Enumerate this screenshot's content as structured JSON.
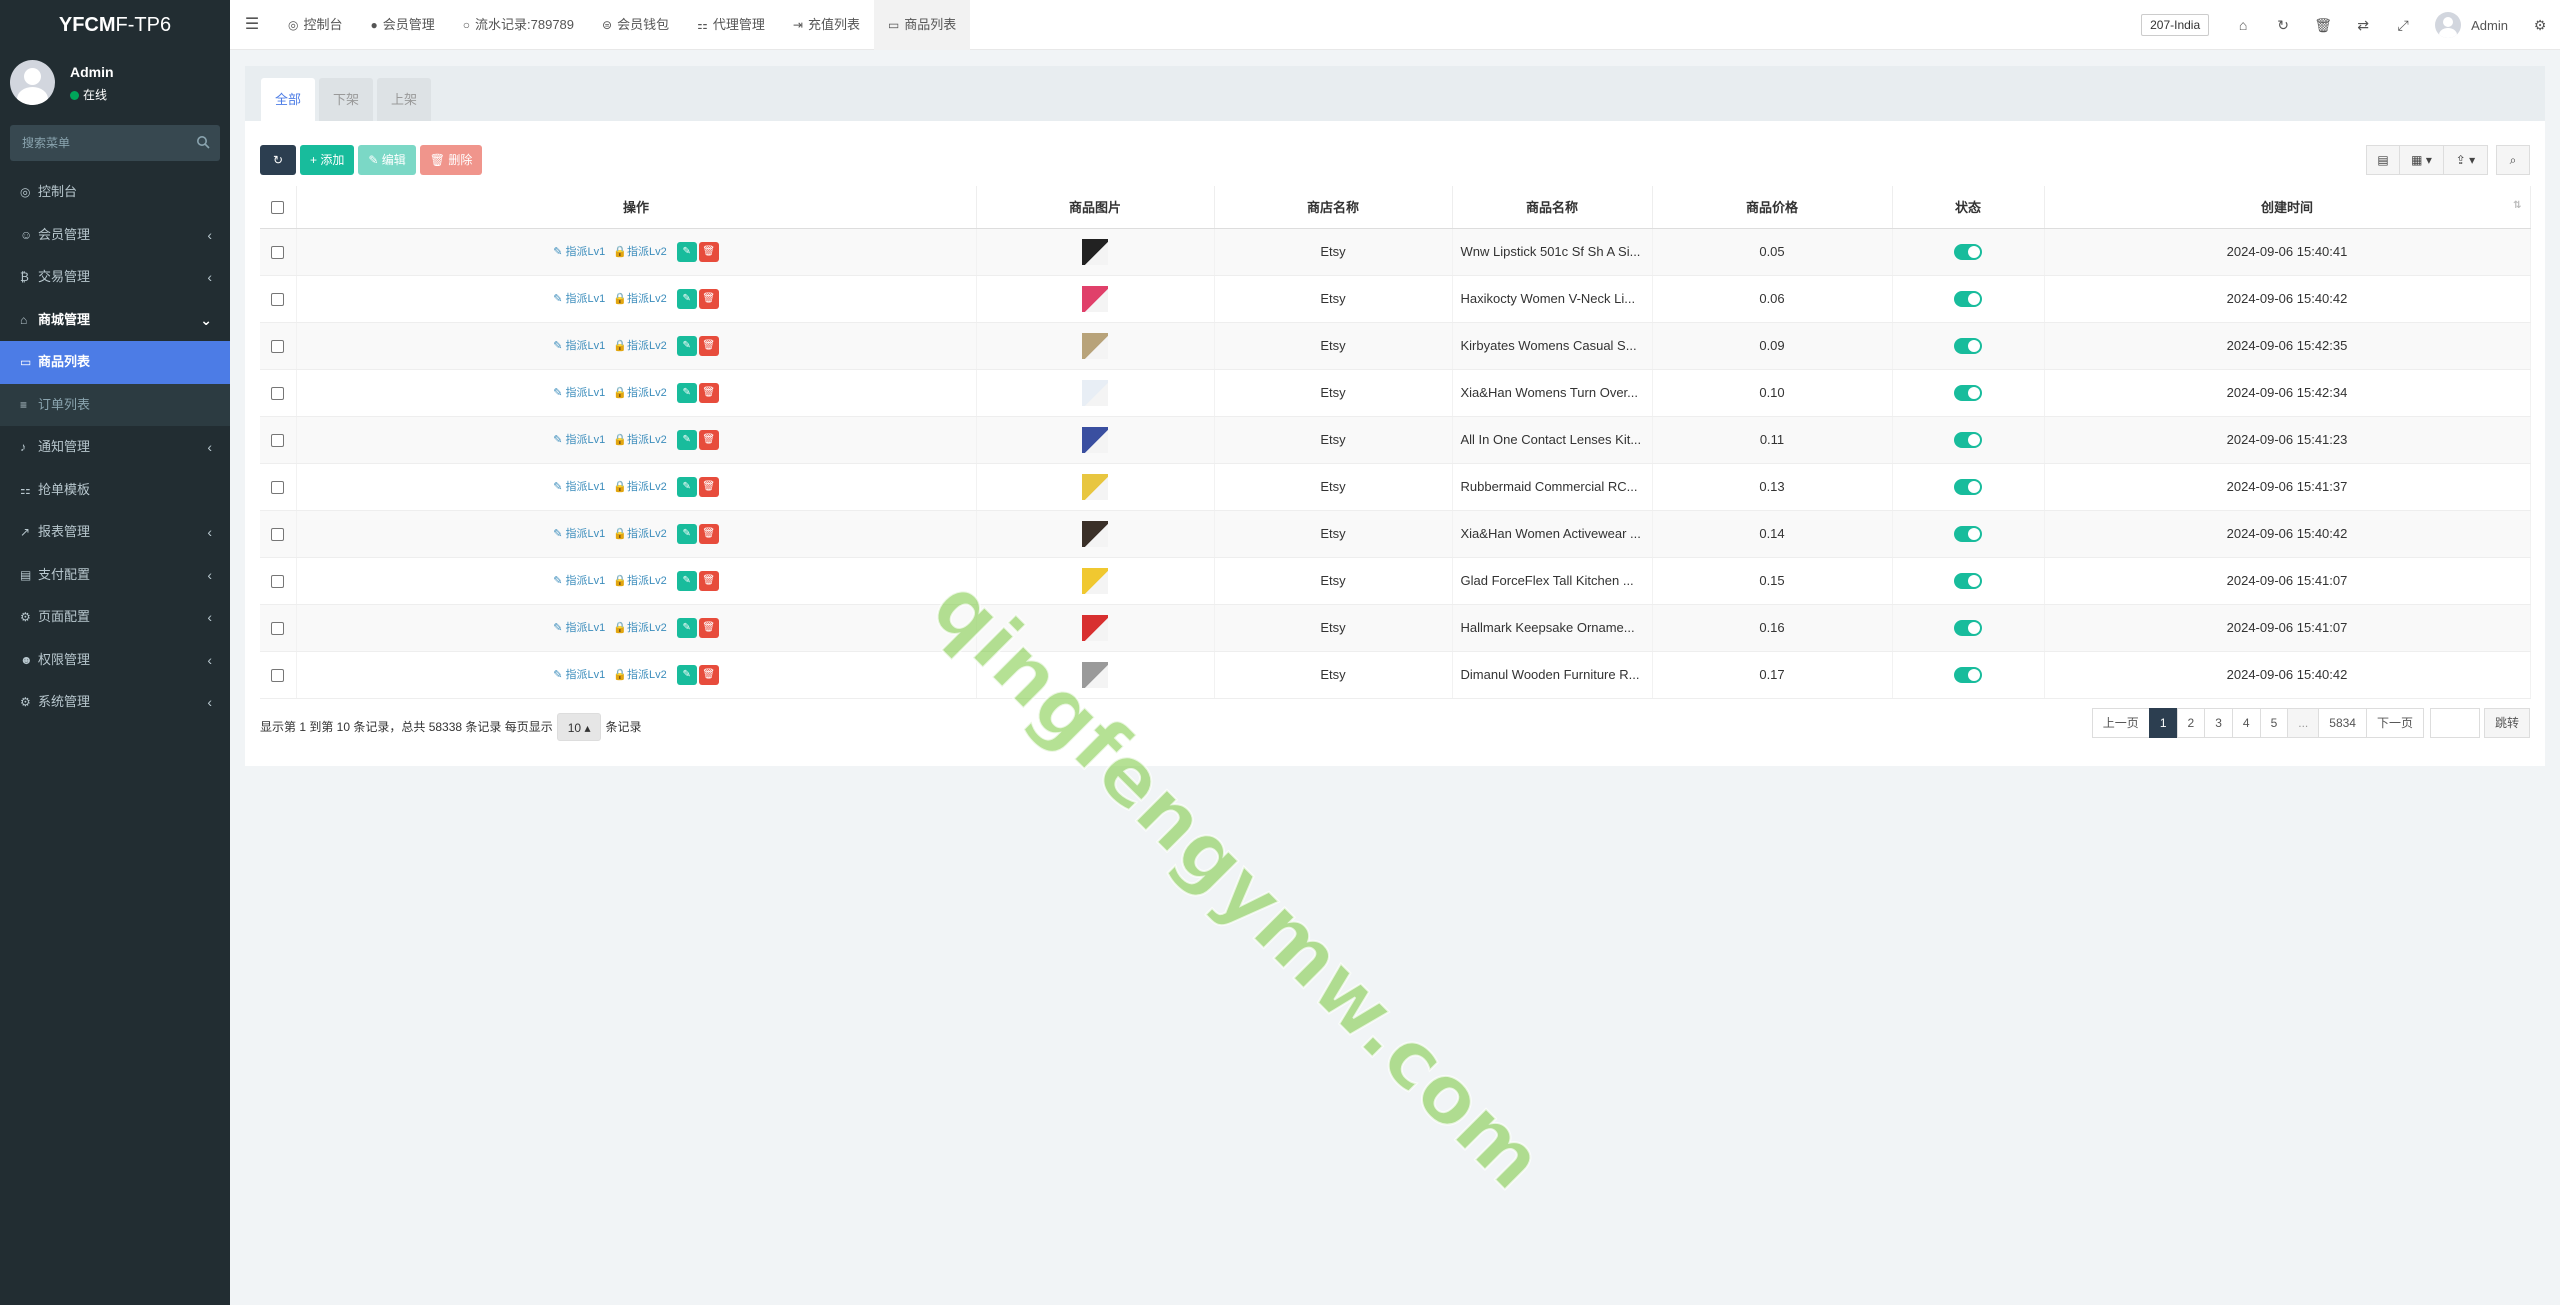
{
  "app": {
    "logo_bold": "YFCM",
    "logo_rest": "F-TP6"
  },
  "user": {
    "name": "Admin",
    "status": "在线"
  },
  "sidebar": {
    "search_placeholder": "搜索菜单",
    "items": [
      {
        "label": "控制台",
        "icon": "dashboard-icon",
        "glyph": "◎",
        "arrow": ""
      },
      {
        "label": "会员管理",
        "icon": "user-circle-icon",
        "glyph": "☺",
        "arrow": "‹"
      },
      {
        "label": "交易管理",
        "icon": "bitcoin-icon",
        "glyph": "₿",
        "arrow": "‹"
      },
      {
        "label": "商城管理",
        "icon": "home-icon",
        "glyph": "⌂",
        "arrow": "⌄"
      },
      {
        "label": "商品列表",
        "icon": "desktop-icon",
        "glyph": "▭",
        "arrow": ""
      },
      {
        "label": "订单列表",
        "icon": "list-icon",
        "glyph": "≡",
        "arrow": ""
      },
      {
        "label": "通知管理",
        "icon": "bell-icon",
        "glyph": "♪",
        "arrow": "‹"
      },
      {
        "label": "抢单模板",
        "icon": "sitemap-icon",
        "glyph": "⚏",
        "arrow": ""
      },
      {
        "label": "报表管理",
        "icon": "line-chart-icon",
        "glyph": "↗",
        "arrow": "‹"
      },
      {
        "label": "支付配置",
        "icon": "credit-card-icon",
        "glyph": "▤",
        "arrow": "‹"
      },
      {
        "label": "页面配置",
        "icon": "gear-icon",
        "glyph": "⚙",
        "arrow": "‹"
      },
      {
        "label": "权限管理",
        "icon": "users-icon",
        "glyph": "☻",
        "arrow": "‹"
      },
      {
        "label": "系统管理",
        "icon": "cogs-icon",
        "glyph": "⚙",
        "arrow": "‹"
      }
    ]
  },
  "topnav": {
    "tabs": [
      {
        "label": "控制台",
        "glyph": "◎"
      },
      {
        "label": "会员管理",
        "glyph": "●"
      },
      {
        "label": "流水记录:789789",
        "glyph": "○"
      },
      {
        "label": "会员钱包",
        "glyph": "⊜"
      },
      {
        "label": "代理管理",
        "glyph": "⚏"
      },
      {
        "label": "充值列表",
        "glyph": "⇥"
      },
      {
        "label": "商品列表",
        "glyph": "▭"
      }
    ],
    "lang": "207-India",
    "user": "Admin"
  },
  "panel": {
    "tabs": [
      "全部",
      "下架",
      "上架"
    ],
    "toolbar": {
      "add": "添加",
      "edit": "编辑",
      "delete": "删除"
    }
  },
  "table": {
    "headers": {
      "op": "操作",
      "img": "商品图片",
      "shop": "商店名称",
      "name": "商品名称",
      "price": "商品价格",
      "status": "状态",
      "created": "创建时间"
    },
    "op_links": {
      "lv1": "指派Lv1",
      "lv2": "指派Lv2"
    },
    "rows": [
      {
        "shop": "Etsy",
        "name": "Wnw Lipstick 501c Sf Sh A Si...",
        "price": "0.05",
        "created": "2024-09-06 15:40:41",
        "thumb": "#222222"
      },
      {
        "shop": "Etsy",
        "name": "Haxikocty Women V-Neck Li...",
        "price": "0.06",
        "created": "2024-09-06 15:40:42",
        "thumb": "#e0406a"
      },
      {
        "shop": "Etsy",
        "name": "Kirbyates Womens Casual S...",
        "price": "0.09",
        "created": "2024-09-06 15:42:35",
        "thumb": "#b8a37a"
      },
      {
        "shop": "Etsy",
        "name": "Xia&Han Womens Turn Over...",
        "price": "0.10",
        "created": "2024-09-06 15:42:34",
        "thumb": "#e8eef5"
      },
      {
        "shop": "Etsy",
        "name": "All In One Contact Lenses Kit...",
        "price": "0.11",
        "created": "2024-09-06 15:41:23",
        "thumb": "#3a4fa0"
      },
      {
        "shop": "Etsy",
        "name": "Rubbermaid Commercial RC...",
        "price": "0.13",
        "created": "2024-09-06 15:41:37",
        "thumb": "#e8c640"
      },
      {
        "shop": "Etsy",
        "name": "Xia&Han Women Activewear ...",
        "price": "0.14",
        "created": "2024-09-06 15:40:42",
        "thumb": "#3a3028"
      },
      {
        "shop": "Etsy",
        "name": "Glad ForceFlex Tall Kitchen ...",
        "price": "0.15",
        "created": "2024-09-06 15:41:07",
        "thumb": "#f0c830"
      },
      {
        "shop": "Etsy",
        "name": "Hallmark Keepsake Orname...",
        "price": "0.16",
        "created": "2024-09-06 15:41:07",
        "thumb": "#d83030"
      },
      {
        "shop": "Etsy",
        "name": "Dimanul Wooden Furniture R...",
        "price": "0.17",
        "created": "2024-09-06 15:40:42",
        "thumb": "#9a9a9a"
      }
    ]
  },
  "footer": {
    "info": "显示第 1 到第 10 条记录，总共 58338 条记录 每页显示",
    "page_size": "10",
    "suffix": "条记录",
    "pager": {
      "prev": "上一页",
      "pages": [
        "1",
        "2",
        "3",
        "4",
        "5",
        "...",
        "5834"
      ],
      "next": "下一页",
      "go": "跳转"
    }
  },
  "watermark": "qingfengymw.com",
  "colors": {
    "sidebar": "#222d32",
    "active": "#4c7ce6",
    "green": "#18bc9c",
    "red": "#e74c3c",
    "dark": "#2c3e50"
  }
}
